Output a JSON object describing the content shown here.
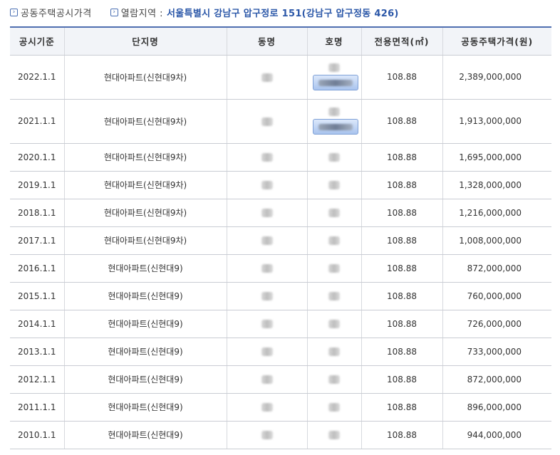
{
  "topbar": {
    "section_label": "공동주택공시가격",
    "region_label": "열람지역 :",
    "region_value": "서울특별시 강남구 압구정로 151(강남구 압구정동 426)"
  },
  "table": {
    "headers": [
      "공시기준",
      "단지명",
      "동명",
      "호명",
      "전용면적(㎡)",
      "공동주택가격(원)"
    ],
    "rows": [
      {
        "date": "2022.1.1",
        "complex": "현대아파트(신현대9차)",
        "area": "108.88",
        "price": "2,389,000,000"
      },
      {
        "date": "2021.1.1",
        "complex": "현대아파트(신현대9차)",
        "area": "108.88",
        "price": "1,913,000,000"
      },
      {
        "date": "2020.1.1",
        "complex": "현대아파트(신현대9차)",
        "area": "108.88",
        "price": "1,695,000,000"
      },
      {
        "date": "2019.1.1",
        "complex": "현대아파트(신현대9차)",
        "area": "108.88",
        "price": "1,328,000,000"
      },
      {
        "date": "2018.1.1",
        "complex": "현대아파트(신현대9차)",
        "area": "108.88",
        "price": "1,216,000,000"
      },
      {
        "date": "2017.1.1",
        "complex": "현대아파트(신현대9차)",
        "area": "108.88",
        "price": "1,008,000,000"
      },
      {
        "date": "2016.1.1",
        "complex": "현대아파트(신현대9)",
        "area": "108.88",
        "price": "872,000,000"
      },
      {
        "date": "2015.1.1",
        "complex": "현대아파트(신현대9)",
        "area": "108.88",
        "price": "760,000,000"
      },
      {
        "date": "2014.1.1",
        "complex": "현대아파트(신현대9)",
        "area": "108.88",
        "price": "726,000,000"
      },
      {
        "date": "2013.1.1",
        "complex": "현대아파트(신현대9)",
        "area": "108.88",
        "price": "733,000,000"
      },
      {
        "date": "2012.1.1",
        "complex": "현대아파트(신현대9)",
        "area": "108.88",
        "price": "872,000,000"
      },
      {
        "date": "2011.1.1",
        "complex": "현대아파트(신현대9)",
        "area": "108.88",
        "price": "896,000,000"
      },
      {
        "date": "2010.1.1",
        "complex": "현대아파트(신현대9)",
        "area": "108.88",
        "price": "944,000,000"
      }
    ]
  },
  "colors": {
    "accent": "#2b57a8",
    "header_bg": "#f2f4f8",
    "header_border": "#4f6fb0"
  },
  "icons": {
    "crumb_icon": "chevron-right-box-icon"
  }
}
